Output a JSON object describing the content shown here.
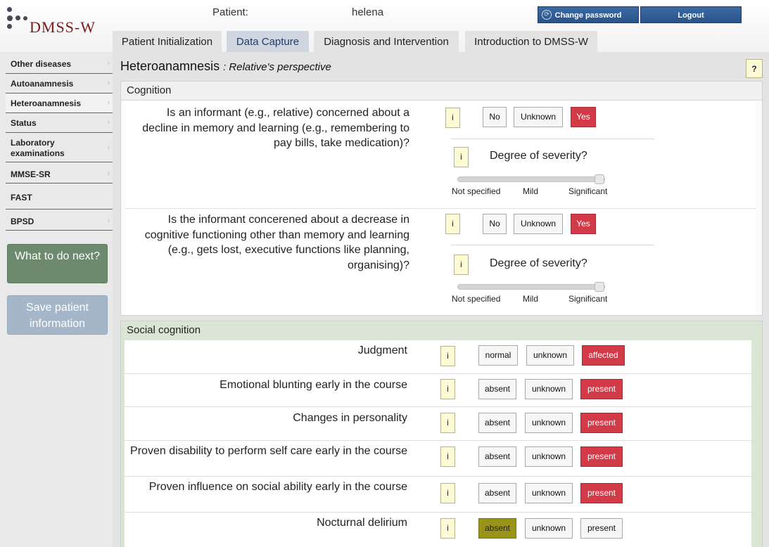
{
  "header": {
    "app_name": "DMSS-W",
    "patient_label": "Patient:",
    "patient_name": "helena",
    "change_password": "Change password",
    "logout": "Logout"
  },
  "tabs": [
    {
      "label": "Patient Initialization",
      "active": false
    },
    {
      "label": "Data Capture",
      "active": true
    },
    {
      "label": "Diagnosis and Intervention",
      "active": false
    },
    {
      "label": "Introduction to DMSS-W",
      "active": false
    }
  ],
  "sidebar": {
    "items": [
      {
        "label": "Other diseases"
      },
      {
        "label": "Autoanamnesis"
      },
      {
        "label": "Heteroanamnesis",
        "active": true
      },
      {
        "label": "Status"
      },
      {
        "label": "Laboratory examinations"
      },
      {
        "label": "MMSE-SR"
      },
      {
        "label": "FAST"
      },
      {
        "label": "BPSD"
      }
    ],
    "what_next": "What to do next?",
    "save_patient": "Save patient information"
  },
  "main": {
    "title": "Heteroanamnesis",
    "subtitle": ": Relative's perspective",
    "help": "?",
    "info_label": "i",
    "cognition": {
      "header": "Cognition",
      "questions": [
        {
          "text": "Is an informant (e.g., relative) concerned about a decline in memory and learning (e.g., remembering to pay bills, take medication)?",
          "options": [
            "No",
            "Unknown",
            "Yes"
          ],
          "selected": "Yes",
          "severity_label": "Degree of severity?",
          "severity_ticks": [
            "Not specified",
            "Mild",
            "Significant"
          ],
          "severity_value": 1.0
        },
        {
          "text": "Is the informant concerened about a decrease in cognitive functioning other than memory and learning (e.g., gets lost, executive functions like planning, organising)?",
          "options": [
            "No",
            "Unknown",
            "Yes"
          ],
          "selected": "Yes",
          "severity_label": "Degree of severity?",
          "severity_ticks": [
            "Not specified",
            "Mild",
            "Significant"
          ],
          "severity_value": 1.0
        }
      ]
    },
    "social": {
      "header": "Social cognition",
      "rows": [
        {
          "text": "Judgment",
          "options": [
            "normal",
            "unknown",
            "affected"
          ],
          "selected": "affected",
          "sel_color": "#d23a48"
        },
        {
          "text": "Emotional blunting early in the course",
          "options": [
            "absent",
            "unknown",
            "present"
          ],
          "selected": "present",
          "sel_color": "#d23a48"
        },
        {
          "text": "Changes in personality",
          "options": [
            "absent",
            "unknown",
            "present"
          ],
          "selected": "present",
          "sel_color": "#d23a48"
        },
        {
          "text": "Proven disability to perform self care early in the course",
          "options": [
            "absent",
            "unknown",
            "present"
          ],
          "selected": "present",
          "sel_color": "#d23a48"
        },
        {
          "text": "Proven influence on social ability early in the course",
          "options": [
            "absent",
            "unknown",
            "present"
          ],
          "selected": "present",
          "sel_color": "#d23a48"
        },
        {
          "text": "Nocturnal delirium",
          "options": [
            "absent",
            "unknown",
            "present"
          ],
          "selected": "absent",
          "sel_color": "#999418"
        }
      ]
    }
  },
  "colors": {
    "accent_blue": "#2a5389",
    "selected_red": "#d23a48",
    "selected_olive": "#999418",
    "what_next_green": "#6e8a6e",
    "save_blue": "#a6b6c9"
  }
}
